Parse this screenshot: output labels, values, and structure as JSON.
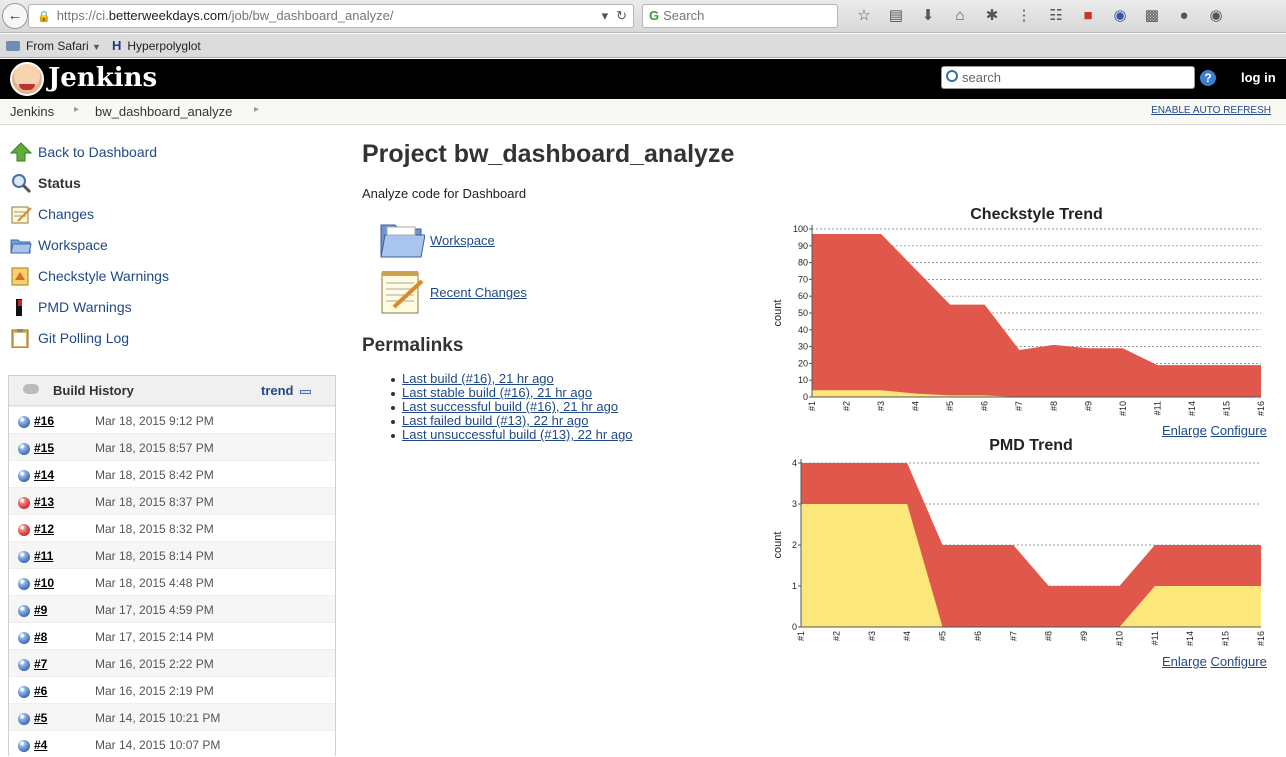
{
  "browser": {
    "url_prefix": "https://ci.",
    "url_host": "betterweekdays.com",
    "url_path": "/job/bw_dashboard_analyze/",
    "search_placeholder": "Search",
    "bookmarks": [
      {
        "label": "From Safari"
      },
      {
        "label": "Hyperpolyglot"
      }
    ],
    "toolbar_icons": [
      "star-icon",
      "reading-list-icon",
      "download-icon",
      "home-icon",
      "bug-icon",
      "footprints-icon",
      "sitemap-icon",
      "puzzle-icon",
      "abp-icon",
      "sleep-icon",
      "chat-icon",
      "color-picker-icon"
    ]
  },
  "header": {
    "title": "Jenkins",
    "search_placeholder": "search",
    "login": "log in"
  },
  "breadcrumbs": [
    "Jenkins",
    "bw_dashboard_analyze"
  ],
  "auto_refresh": "ENABLE AUTO REFRESH",
  "tasks": [
    {
      "label": "Back to Dashboard",
      "icon": "up-arrow-icon"
    },
    {
      "label": "Status",
      "icon": "magnifier-icon"
    },
    {
      "label": "Changes",
      "icon": "notepad-icon"
    },
    {
      "label": "Workspace",
      "icon": "folder-icon"
    },
    {
      "label": "Checkstyle Warnings",
      "icon": "checkstyle-icon"
    },
    {
      "label": "PMD Warnings",
      "icon": "pmd-icon"
    },
    {
      "label": "Git Polling Log",
      "icon": "clipboard-icon"
    }
  ],
  "build_history": {
    "title": "Build History",
    "trend": "trend",
    "builds": [
      {
        "num": "#16",
        "date": "Mar 18, 2015 9:12 PM",
        "status": "blue"
      },
      {
        "num": "#15",
        "date": "Mar 18, 2015 8:57 PM",
        "status": "blue"
      },
      {
        "num": "#14",
        "date": "Mar 18, 2015 8:42 PM",
        "status": "blue"
      },
      {
        "num": "#13",
        "date": "Mar 18, 2015 8:37 PM",
        "status": "red"
      },
      {
        "num": "#12",
        "date": "Mar 18, 2015 8:32 PM",
        "status": "red"
      },
      {
        "num": "#11",
        "date": "Mar 18, 2015 8:14 PM",
        "status": "blue"
      },
      {
        "num": "#10",
        "date": "Mar 18, 2015 4:48 PM",
        "status": "blue"
      },
      {
        "num": "#9",
        "date": "Mar 17, 2015 4:59 PM",
        "status": "blue"
      },
      {
        "num": "#8",
        "date": "Mar 17, 2015 2:14 PM",
        "status": "blue"
      },
      {
        "num": "#7",
        "date": "Mar 16, 2015 2:22 PM",
        "status": "blue"
      },
      {
        "num": "#6",
        "date": "Mar 16, 2015 2:19 PM",
        "status": "blue"
      },
      {
        "num": "#5",
        "date": "Mar 14, 2015 10:21 PM",
        "status": "blue"
      },
      {
        "num": "#4",
        "date": "Mar 14, 2015 10:07 PM",
        "status": "blue"
      }
    ]
  },
  "main": {
    "title": "Project bw_dashboard_analyze",
    "description": "Analyze code for Dashboard",
    "workspace_link": "Workspace",
    "recent_changes_link": "Recent Changes",
    "permalinks_heading": "Permalinks",
    "permalinks": [
      "Last build (#16), 21 hr ago",
      "Last stable build (#16), 21 hr ago",
      "Last successful build (#16), 21 hr ago",
      "Last failed build (#13), 22 hr ago",
      "Last unsuccessful build (#13), 22 hr ago"
    ]
  },
  "chart_links": {
    "enlarge": "Enlarge",
    "configure": "Configure"
  },
  "colors": {
    "high": "#e0584c",
    "normal": "#fce77a",
    "link": "#204a87"
  },
  "chart_data": [
    {
      "type": "area",
      "title": "Checkstyle Trend",
      "ylabel": "count",
      "xlabel": "",
      "ylim": [
        0,
        100
      ],
      "yticks": [
        0,
        10,
        20,
        30,
        40,
        50,
        60,
        70,
        80,
        90,
        100
      ],
      "x": [
        "#1",
        "#2",
        "#3",
        "#4",
        "#5",
        "#6",
        "#7",
        "#8",
        "#9",
        "#10",
        "#11",
        "#14",
        "#15",
        "#16"
      ],
      "series": [
        {
          "values": [
            4,
            4,
            4,
            2,
            1,
            1,
            0,
            0,
            0,
            0,
            0,
            0,
            0,
            0
          ]
        },
        {
          "values": [
            97,
            97,
            97,
            76,
            55,
            55,
            28,
            31,
            29,
            29,
            19,
            19,
            19,
            19
          ]
        }
      ],
      "grid": true,
      "stacked": false
    },
    {
      "type": "area",
      "title": "PMD Trend",
      "ylabel": "count",
      "xlabel": "",
      "ylim": [
        0,
        4
      ],
      "yticks": [
        0,
        1,
        2,
        3,
        4
      ],
      "x": [
        "#1",
        "#2",
        "#3",
        "#4",
        "#5",
        "#6",
        "#7",
        "#8",
        "#9",
        "#10",
        "#11",
        "#14",
        "#15",
        "#16"
      ],
      "series": [
        {
          "values": [
            3,
            3,
            3,
            3,
            0,
            0,
            0,
            0,
            0,
            0,
            1,
            1,
            1,
            1
          ]
        },
        {
          "values": [
            4,
            4,
            4,
            4,
            2,
            2,
            2,
            1,
            1,
            1,
            2,
            2,
            2,
            2
          ]
        }
      ],
      "grid": true,
      "stacked": false
    }
  ]
}
